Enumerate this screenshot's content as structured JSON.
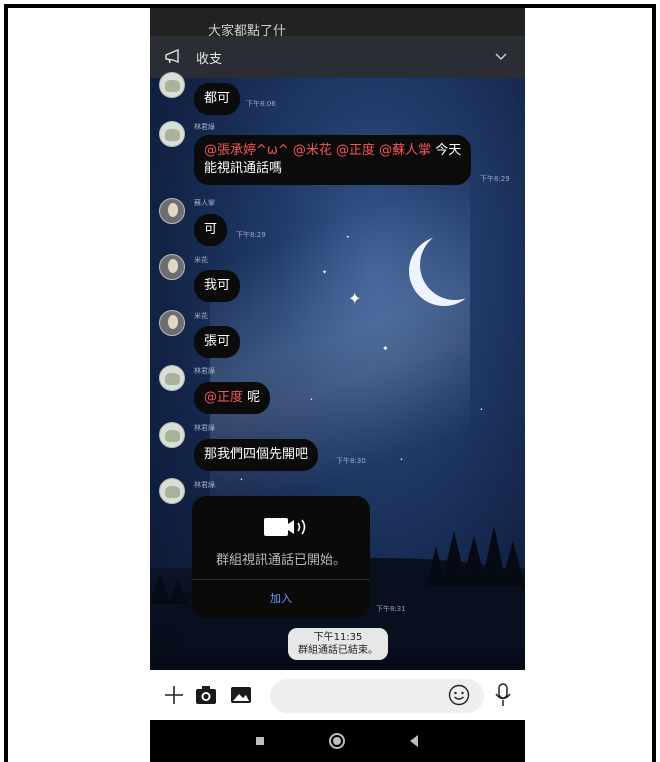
{
  "top_notice": {
    "label": "收支",
    "peek_text": "大家都點了什"
  },
  "messages": [
    {
      "id": "m1",
      "sender": "",
      "text": "都可",
      "time": "下午8:06"
    },
    {
      "id": "m2",
      "sender": "林君綠",
      "mentions": [
        "@張承婷^ω^",
        "@米花",
        "@正度",
        "@蘇人掌"
      ],
      "text_after": "今天",
      "text_line2": "能視訊通話嗎",
      "time": "下午8:29"
    },
    {
      "id": "m3",
      "sender": "蘇人掌",
      "text": "可",
      "time": "下午8:29"
    },
    {
      "id": "m4",
      "sender": "米花",
      "text": "我可",
      "time": ""
    },
    {
      "id": "m5",
      "sender": "米花",
      "text": "張可",
      "time": ""
    },
    {
      "id": "m6",
      "sender": "林君綠",
      "mention": "@正度",
      "text_after": "呢",
      "time": ""
    },
    {
      "id": "m7",
      "sender": "林君綠",
      "text": "那我們四個先開吧",
      "time": "下午8:30"
    },
    {
      "id": "m8",
      "sender": "林君綠",
      "time": "下午8:31"
    }
  ],
  "call_card": {
    "text": "群組視訊通話已開始。",
    "join_label": "加入"
  },
  "system_message": {
    "time": "下午11:35",
    "text": "群組通話已結束。"
  },
  "input_bar": {
    "icons": [
      "plus-icon",
      "camera-icon",
      "image-icon",
      "emoji-icon",
      "mic-icon"
    ]
  },
  "navbar": {
    "icons": [
      "recent-apps-icon",
      "home-icon",
      "back-icon"
    ]
  },
  "colors": {
    "mention": "#f25757",
    "join_link": "#6d9cff",
    "bubble_bg": "#0b0b0c",
    "topbar_bg": "#2b2d34"
  }
}
